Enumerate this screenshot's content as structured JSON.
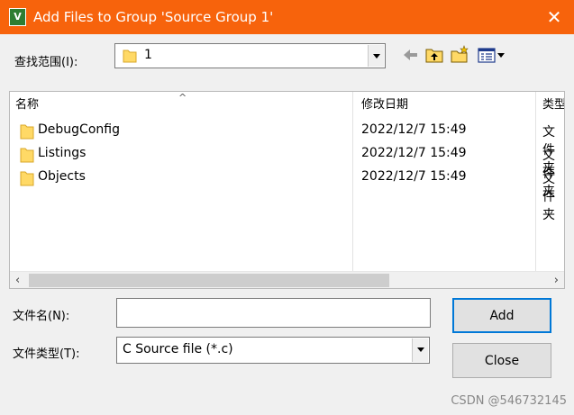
{
  "window": {
    "app_icon_text": "V",
    "title": "Add Files to Group 'Source Group 1'",
    "close_glyph": "✕"
  },
  "lookin": {
    "label": "查找范围(I):",
    "value": "1"
  },
  "file_list": {
    "columns": [
      "名称",
      "修改日期",
      "类型"
    ],
    "sort_glyph": "^",
    "rows": [
      {
        "name": "DebugConfig",
        "date": "2022/12/7 15:49",
        "type": "文件夹"
      },
      {
        "name": "Listings",
        "date": "2022/12/7 15:49",
        "type": "文件夹"
      },
      {
        "name": "Objects",
        "date": "2022/12/7 15:49",
        "type": "文件夹"
      }
    ],
    "scroll_left": "‹",
    "scroll_right": "›"
  },
  "file_name": {
    "label": "文件名(N):",
    "value": ""
  },
  "file_type": {
    "label": "文件类型(T):",
    "value": "C Source file (*.c)"
  },
  "buttons": {
    "add": "Add",
    "close": "Close"
  },
  "toolbar_icons": [
    "back-arrow-icon",
    "up-folder-icon",
    "new-folder-icon",
    "view-menu-icon"
  ],
  "watermark": "CSDN @546732145",
  "colors": {
    "titlebar": "#f7630c",
    "folder": "#ffd966",
    "accent": "#0078d7"
  }
}
